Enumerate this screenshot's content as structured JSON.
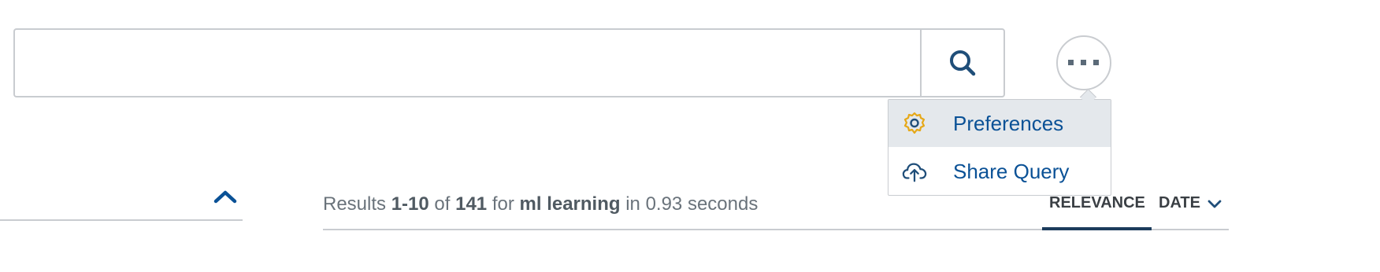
{
  "search": {
    "value": "",
    "placeholder": ""
  },
  "icons": {
    "search": "search-icon",
    "more": "more-horizontal-icon",
    "preferences": "gear-icon",
    "share": "cloud-upload-icon",
    "collapse": "chevron-up-icon",
    "sort_direction": "chevron-down-icon"
  },
  "menu": {
    "items": [
      {
        "label": "Preferences",
        "icon": "gear-icon",
        "active": true
      },
      {
        "label": "Share Query",
        "icon": "cloud-upload-icon",
        "active": false
      }
    ]
  },
  "results": {
    "prefix": "Results",
    "range": "1-10",
    "of_text": "of",
    "total": "141",
    "for_text": "for",
    "query": "ml learning",
    "time_text": "in 0.93 seconds"
  },
  "sort": {
    "relevance_label": "RELEVANCE",
    "date_label": "DATE",
    "selected": "RELEVANCE"
  },
  "colors": {
    "accent": "#0a5196",
    "icon_dark": "#1f4e79",
    "gear": "#e6a817",
    "menu_highlight": "#e4e8ec",
    "border": "#c9ccd0",
    "sort_underline": "#1c3c5c"
  }
}
